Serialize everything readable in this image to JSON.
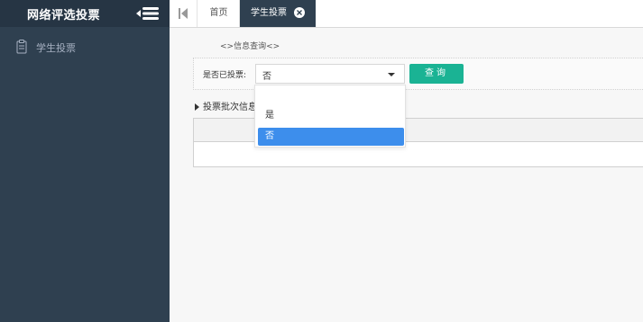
{
  "app": {
    "title": "网络评选投票"
  },
  "sidebar": {
    "items": [
      {
        "label": "学生投票",
        "icon": "clipboard-icon"
      }
    ]
  },
  "tabs": {
    "home_label": "首页",
    "active_label": "学生投票"
  },
  "breadcrumb": "<>信息查询<>",
  "query": {
    "label": "是否已投票:",
    "selected": "否",
    "options": [
      "是",
      "否"
    ],
    "button_label": "查询"
  },
  "section": {
    "title": "投票批次信息"
  },
  "colors": {
    "sidebar": "#2f4050",
    "primary_button": "#1ab394",
    "selected_option": "#3d8eec"
  }
}
